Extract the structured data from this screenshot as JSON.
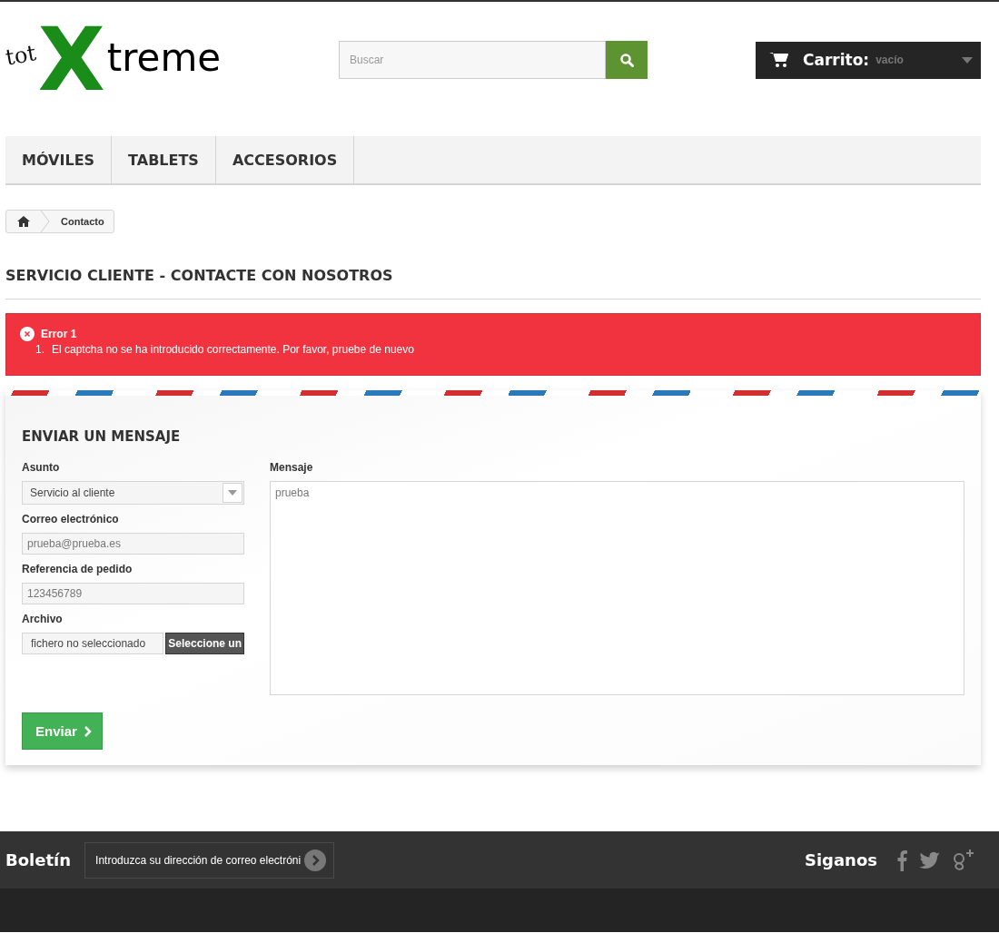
{
  "logo": {
    "prefix": "tot",
    "mark": "X",
    "suffix": "treme"
  },
  "search": {
    "placeholder": "Buscar"
  },
  "cart": {
    "label": "Carrito:",
    "status": "vacío"
  },
  "menu": [
    {
      "label": "MÓVILES"
    },
    {
      "label": "TABLETS"
    },
    {
      "label": "ACCESORIOS"
    }
  ],
  "breadcrumb": [
    "Contacto"
  ],
  "page_title": "SERVICIO CLIENTE - CONTACTE CON NOSOTROS",
  "error": {
    "title": "Error 1",
    "items": [
      {
        "number": "1.",
        "text": "El captcha no se ha introducido correctamente. Por favor, pruebe de nuevo"
      }
    ]
  },
  "form": {
    "title": "ENVIAR UN MENSAJE",
    "fields": [
      {
        "kind": "select",
        "label": "Asunto",
        "value": "Servicio al cliente"
      },
      {
        "kind": "text",
        "label": "Correo electrónico",
        "value": "prueba@prueba.es"
      },
      {
        "kind": "text",
        "label": "Referencia de pedido",
        "value": "123456789"
      },
      {
        "kind": "file",
        "label": "Archivo",
        "value": "fichero no seleccionado",
        "button": "Seleccione un"
      }
    ],
    "message": {
      "label": "Mensaje",
      "value": "prueba"
    },
    "submit": "Enviar"
  },
  "footer": {
    "newsletter": {
      "title": "Boletín",
      "placeholder": "Introduzca su dirección de correo electróni"
    },
    "follow": "Siganos"
  }
}
